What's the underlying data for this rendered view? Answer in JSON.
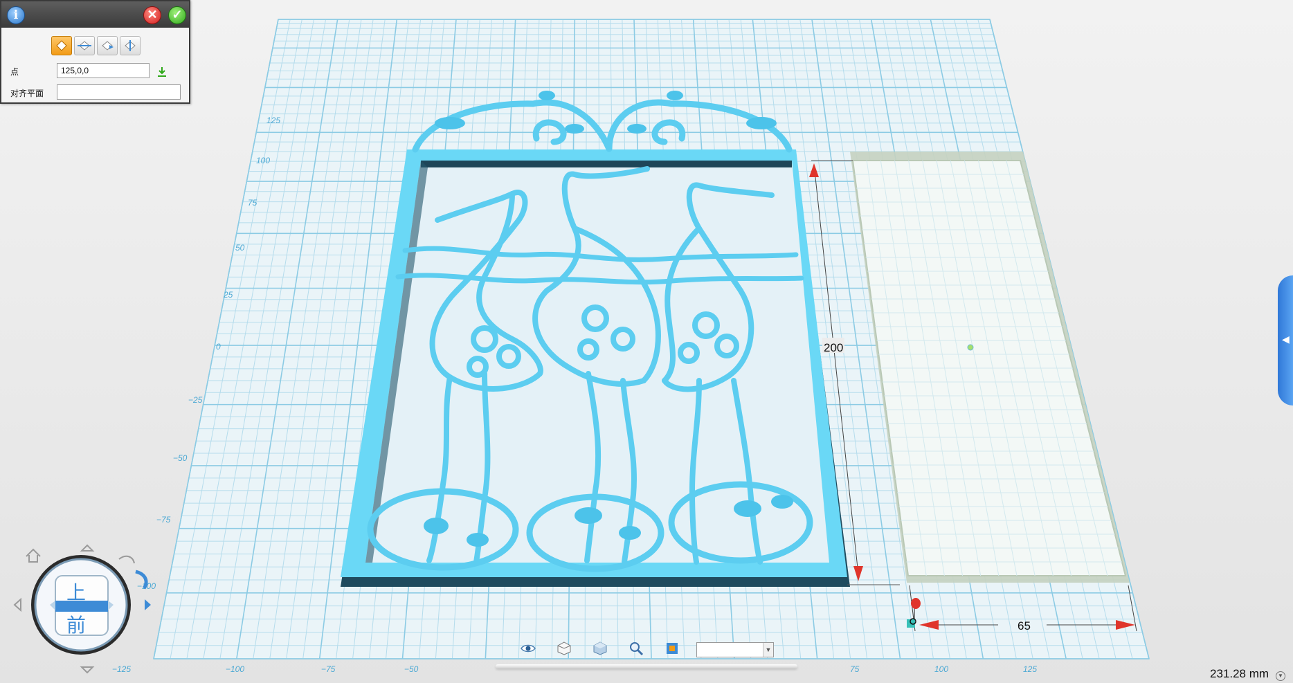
{
  "dialog": {
    "mode_buttons": [
      "point-align-mode",
      "edge-align-mode",
      "face-align-mode",
      "center-align-mode"
    ],
    "point_label": "点",
    "point_value": "125,0,0",
    "plane_label": "对齐平面",
    "plane_value": ""
  },
  "grid_axis_labels": {
    "y": [
      "125",
      "100",
      "75",
      "50",
      "25",
      "0",
      "−25",
      "−50",
      "−75",
      "−100"
    ],
    "x": [
      "−125",
      "−100",
      "−75",
      "−50",
      "75",
      "100",
      "125"
    ]
  },
  "dimensions": {
    "height": "200",
    "width": "65"
  },
  "view_cube": {
    "top_label": "上",
    "front_label": "前"
  },
  "toolbar": {
    "icons": [
      "eye-icon",
      "cube-wireframe-icon",
      "cube-solid-icon",
      "zoom-icon",
      "render-mode-icon"
    ],
    "select_value": ""
  },
  "status": {
    "measurement": "231.28 mm"
  },
  "colors": {
    "model": "#66d4f2",
    "grid": "#a8d8ea",
    "background": "#ececec"
  }
}
